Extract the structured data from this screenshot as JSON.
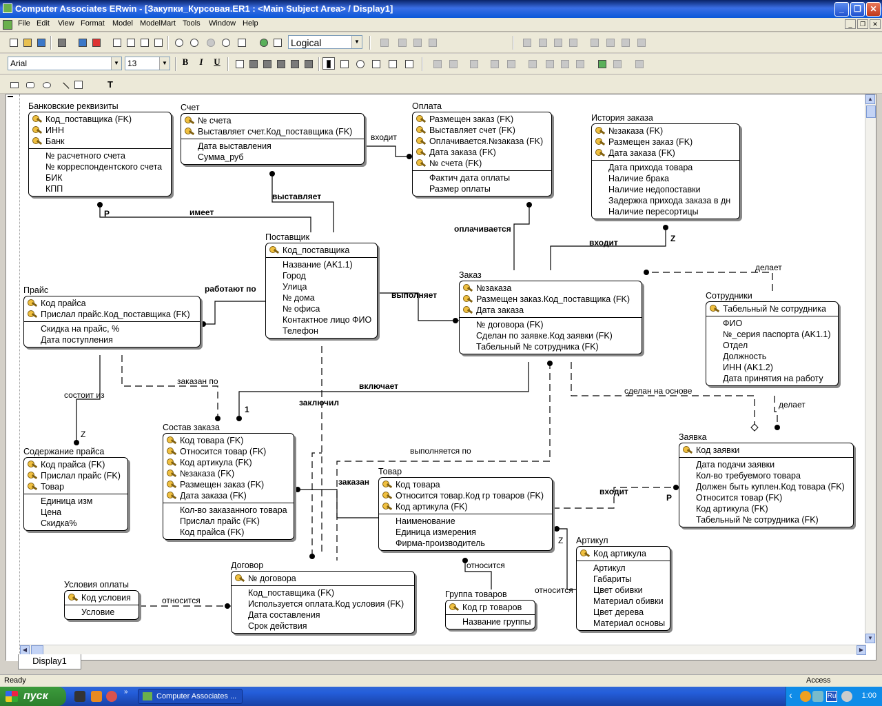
{
  "window": {
    "title": "Computer Associates ERwin - [Закупки_Курсовая.ER1 : <Main Subject Area> / Display1]",
    "min": "_",
    "max": "❐",
    "close": "✕"
  },
  "menu": [
    "File",
    "Edit",
    "View",
    "Format",
    "Model",
    "ModelMart",
    "Tools",
    "Window",
    "Help"
  ],
  "toolbar": {
    "view_mode": "Logical",
    "font": "Arial",
    "font_size": "13",
    "bold": "B",
    "italic": "I",
    "underline": "U",
    "text_tool": "T"
  },
  "tab": "Display1",
  "status": {
    "left": "Ready",
    "right": "Access"
  },
  "taskbar": {
    "start": "пуск",
    "task": "Computer Associates ...",
    "lang": "Ru",
    "clock": "1:00"
  },
  "entities": [
    {
      "id": "bank",
      "name": "Банковские реквизиты",
      "keys": [
        "Код_поставщика (FK)",
        "ИНН",
        "Банк"
      ],
      "attrs": [
        "№ расчетного счета",
        "№ корреспондентского счета",
        "БИК",
        "КПП"
      ]
    },
    {
      "id": "schet",
      "name": "Счет",
      "keys": [
        "№ счета",
        "Выставляет счет.Код_поставщика (FK)"
      ],
      "attrs": [
        "Дата выставления",
        "Сумма_руб"
      ]
    },
    {
      "id": "oplata",
      "name": "Оплата",
      "keys": [
        "Размещен заказ (FK)",
        "Выставляет счет (FK)",
        "Оплачивается.№заказа (FK)",
        "Дата заказа (FK)",
        "№ счета (FK)"
      ],
      "attrs": [
        "Фактич дата оплаты",
        "Размер оплаты"
      ]
    },
    {
      "id": "istoria",
      "name": "История заказа",
      "keys": [
        "№заказа (FK)",
        "Размещен заказ (FK)",
        "Дата заказа (FK)"
      ],
      "attrs": [
        "Дата прихода товара",
        "Наличие брака",
        "Наличие недопоставки",
        "Задержка прихода заказа в дн",
        "Наличие пересортицы"
      ]
    },
    {
      "id": "postavshik",
      "name": "Поставщик",
      "keys": [
        "Код_поставщика"
      ],
      "attrs": [
        "Название (AK1.1)",
        "Город",
        "Улица",
        "№ дома",
        "№ офиса",
        "Контактное лицо ФИО",
        "Телефон"
      ]
    },
    {
      "id": "prais",
      "name": "Прайс",
      "keys": [
        "Код прайса",
        "Прислал прайс.Код_поставщика (FK)"
      ],
      "attrs": [
        "Скидка на прайс, %",
        "Дата поступления"
      ]
    },
    {
      "id": "zakaz",
      "name": "Заказ",
      "keys": [
        "№заказа",
        "Размещен заказ.Код_поставщика (FK)",
        "Дата заказа"
      ],
      "attrs": [
        "№ договора (FK)",
        "Сделан по заявке.Код заявки (FK)",
        "Табельный № сотрудника (FK)"
      ]
    },
    {
      "id": "sotrudniki",
      "name": "Сотрудники",
      "keys": [
        "Табельный № сотрудника"
      ],
      "attrs": [
        "ФИО",
        "№_серия паспорта (AK1.1)",
        "Отдел",
        "Должность",
        "ИНН (AK1.2)",
        "Дата принятия на работу"
      ]
    },
    {
      "id": "soderzhanie",
      "name": "Содержание прайса",
      "keys": [
        "Код прайса (FK)",
        "Прислал прайс (FK)",
        "Товар"
      ],
      "attrs": [
        "Единица изм",
        "Цена",
        "Скидка%"
      ]
    },
    {
      "id": "sostav",
      "name": "Состав заказа",
      "keys": [
        "Код товара (FK)",
        "Относится товар (FK)",
        "Код артикула (FK)",
        "№заказа (FK)",
        "Размещен заказ (FK)",
        "Дата заказа (FK)"
      ],
      "attrs": [
        "Кол-во заказанного товара",
        "Прислал прайс (FK)",
        "Код прайса (FK)"
      ]
    },
    {
      "id": "zayavka",
      "name": "Заявка",
      "keys": [
        "Код заявки"
      ],
      "attrs": [
        "Дата подачи заявки",
        "Кол-во требуемого товара",
        "Должен быть куплен.Код товара (FK)",
        "Относится товар (FK)",
        "Код артикула (FK)",
        "Табельный № сотрудника (FK)"
      ]
    },
    {
      "id": "tovar",
      "name": "Товар",
      "keys": [
        "Код товара",
        "Относится товар.Код гр товаров (FK)",
        "Код артикула (FK)"
      ],
      "attrs": [
        "Наименование",
        "Единица измерения",
        "Фирма-производитель"
      ]
    },
    {
      "id": "artikul",
      "name": "Артикул",
      "keys": [
        "Код артикула"
      ],
      "attrs": [
        "Артикул",
        "Габариты",
        "Цвет обивки",
        "Материал обивки",
        "Цвет дерева",
        "Материал основы"
      ]
    },
    {
      "id": "usloviya",
      "name": "Условия оплаты",
      "keys": [
        "Код условия"
      ],
      "attrs": [
        "Условие"
      ]
    },
    {
      "id": "dogovor",
      "name": "Договор",
      "keys": [
        "№ договора"
      ],
      "attrs": [
        "Код_поставщика (FK)",
        "Используется оплата.Код условия (FK)",
        "Дата составления",
        "Срок действия"
      ]
    },
    {
      "id": "gruppa",
      "name": "Группа товаров",
      "keys": [
        "Код гр товаров"
      ],
      "attrs": [
        "Название группы"
      ]
    }
  ],
  "relations": [
    {
      "id": "r_imeet",
      "text": "имеет"
    },
    {
      "id": "r_p1",
      "text": "P"
    },
    {
      "id": "r_vystavlyaet",
      "text": "выставляет"
    },
    {
      "id": "r_vhodit1",
      "text": "входит"
    },
    {
      "id": "r_oplachivaetsya",
      "text": "оплачивается"
    },
    {
      "id": "r_vhodit2",
      "text": "входит"
    },
    {
      "id": "r_z1",
      "text": "Z"
    },
    {
      "id": "r_delaet1",
      "text": "делает"
    },
    {
      "id": "r_rabotayut",
      "text": "работают по"
    },
    {
      "id": "r_vypolnyaet",
      "text": "выполняет"
    },
    {
      "id": "r_zakazan_po",
      "text": "заказан по"
    },
    {
      "id": "r_sostoit",
      "text": "состоит из"
    },
    {
      "id": "r_z2",
      "text": "Z"
    },
    {
      "id": "r_vklyuchaet",
      "text": "включает"
    },
    {
      "id": "r_1",
      "text": "1"
    },
    {
      "id": "r_zaklyuchil",
      "text": "заключил"
    },
    {
      "id": "r_sdelan",
      "text": "сделан на основе"
    },
    {
      "id": "r_delaet2",
      "text": "делает"
    },
    {
      "id": "r_vypolnyaetsya",
      "text": "выполняется по"
    },
    {
      "id": "r_zakazan",
      "text": "заказан"
    },
    {
      "id": "r_vhodit3",
      "text": "входит"
    },
    {
      "id": "r_p2",
      "text": "P"
    },
    {
      "id": "r_z3",
      "text": "Z"
    },
    {
      "id": "r_otnositsya1",
      "text": "относится"
    },
    {
      "id": "r_otnositsya2",
      "text": "относится"
    },
    {
      "id": "r_otnositsya3",
      "text": "относится"
    }
  ]
}
